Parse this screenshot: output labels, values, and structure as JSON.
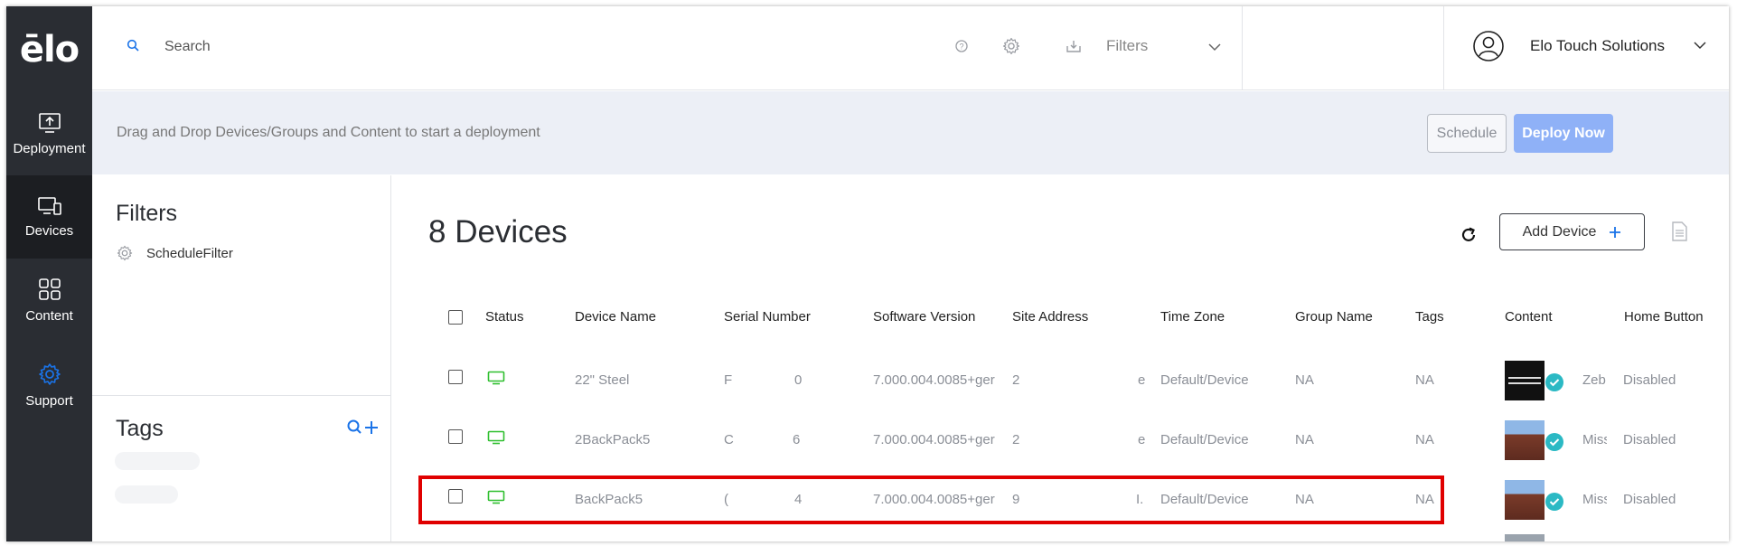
{
  "app": {
    "logo": "ēlo"
  },
  "sidebar": {
    "items": [
      {
        "label": "Deployment",
        "icon": "deploy-icon",
        "active": false
      },
      {
        "label": "Devices",
        "icon": "devices-icon",
        "active": true
      },
      {
        "label": "Content",
        "icon": "content-icon",
        "active": false
      },
      {
        "label": "Support",
        "icon": "gear-icon",
        "active": false
      }
    ]
  },
  "topbar": {
    "search_placeholder": "Search",
    "filters_label": "Filters",
    "user_name": "Elo Touch Solutions"
  },
  "banner": {
    "text": "Drag and Drop Devices/Groups and Content to start a deployment",
    "schedule_label": "Schedule",
    "deploy_label": "Deploy Now"
  },
  "filters_panel": {
    "title": "Filters",
    "items": [
      {
        "name": "ScheduleFilter"
      }
    ],
    "tags_title": "Tags"
  },
  "main": {
    "title": "8 Devices",
    "add_device_label": "Add Device",
    "columns": [
      "Status",
      "Device Name",
      "Serial Number",
      "Software Version",
      "Site Address",
      "Time Zone",
      "Group Name",
      "Tags",
      "Content",
      "Home Button"
    ],
    "rows": [
      {
        "device_name": "22\" Steel",
        "serial_start": "F",
        "serial_end": "0",
        "software_version": "7.000.004.0085+ger",
        "site_start": "2",
        "site_end": "e",
        "time_zone": "Default/Device",
        "group_name": "NA",
        "tags": "NA",
        "content_name": "Zeb",
        "home_button": "Disabled",
        "highlighted": false
      },
      {
        "device_name": "2BackPack5",
        "serial_start": "C",
        "serial_end": "6",
        "software_version": "7.000.004.0085+ger",
        "site_start": "2",
        "site_end": "e",
        "time_zone": "Default/Device",
        "group_name": "NA",
        "tags": "NA",
        "content_name": "Miss",
        "home_button": "Disabled",
        "highlighted": false
      },
      {
        "device_name": "BackPack5",
        "serial_start": "(",
        "serial_end": "4",
        "software_version": "7.000.004.0085+ger",
        "site_start": "9",
        "site_end": "I.",
        "time_zone": "Default/Device",
        "group_name": "NA",
        "tags": "NA",
        "content_name": "Miss",
        "home_button": "Disabled",
        "highlighted": true
      }
    ]
  },
  "colors": {
    "sidebar_bg": "#2a2d33",
    "accent_blue": "#1a73e8",
    "deploy_button": "#8fb1f7",
    "status_online": "#2fbf2f",
    "badge_teal": "#2bb9c4",
    "highlight_red": "#e00000"
  }
}
